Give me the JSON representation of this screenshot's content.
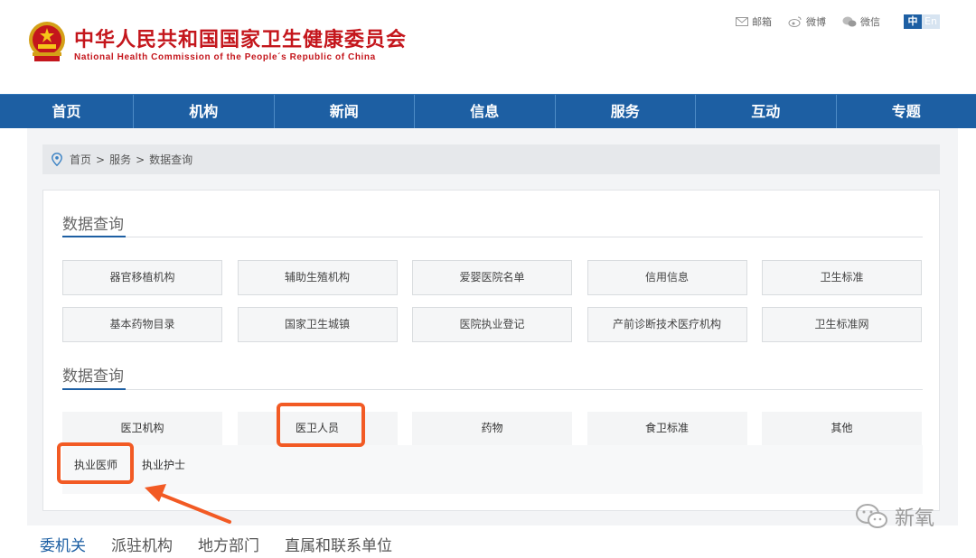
{
  "header": {
    "title_cn": "中华人民共和国国家卫生健康委员会",
    "title_en": "National Health Commission of the People´s Republic of China",
    "toplinks": [
      {
        "label": "邮箱",
        "icon": "mail-icon"
      },
      {
        "label": "微博",
        "icon": "weibo-icon"
      },
      {
        "label": "微信",
        "icon": "wechat-icon"
      }
    ],
    "lang_zh": "中",
    "lang_en": "En"
  },
  "nav": {
    "items": [
      "首页",
      "机构",
      "新闻",
      "信息",
      "服务",
      "互动",
      "专题"
    ]
  },
  "breadcrumb": {
    "items": [
      "首页",
      "服务",
      "数据查询"
    ],
    "separator": ">"
  },
  "section1": {
    "title": "数据查询",
    "cells": [
      "器官移植机构",
      "辅助生殖机构",
      "爱婴医院名单",
      "信用信息",
      "卫生标准",
      "基本药物目录",
      "国家卫生城镇",
      "医院执业登记",
      "产前诊断技术医疗机构",
      "卫生标准网"
    ]
  },
  "section2": {
    "title": "数据查询",
    "tabs": [
      "医卫机构",
      "医卫人员",
      "药物",
      "食卫标准",
      "其他"
    ],
    "subtabs": [
      "执业医师",
      "执业护士"
    ]
  },
  "bottom_links": [
    "委机关",
    "派驻机构",
    "地方部门",
    "直属和联系单位"
  ],
  "watermark": "新氧",
  "colors": {
    "brand_red": "#c4161c",
    "nav_blue": "#1d5fa3",
    "annotation_orange": "#f25a24"
  }
}
